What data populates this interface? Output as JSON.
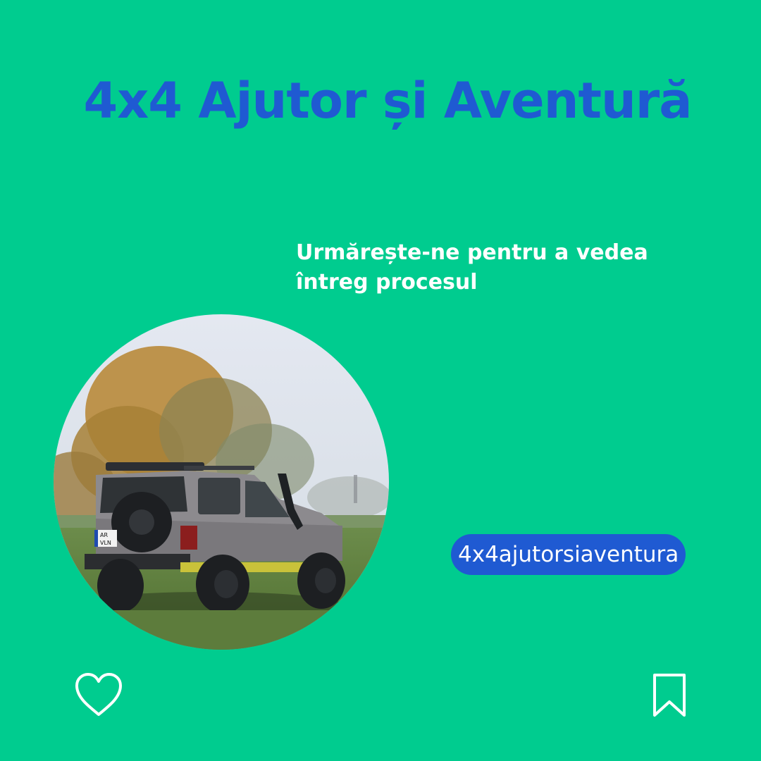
{
  "post": {
    "title": "4x4 Ajutor și Aventură",
    "subtitle_line1": "Urmărește-ne pentru a vedea",
    "subtitle_line2": "întreg procesul",
    "hashtag": "4x4ajutorsiaventura",
    "license_plate_line1": "AR",
    "license_plate_line2": "VLN"
  },
  "icons": {
    "like": "heart-outline-icon",
    "save": "bookmark-outline-icon"
  },
  "colors": {
    "background": "#00cc8f",
    "accent_blue": "#1f5ad2",
    "text_white": "#ffffff"
  }
}
